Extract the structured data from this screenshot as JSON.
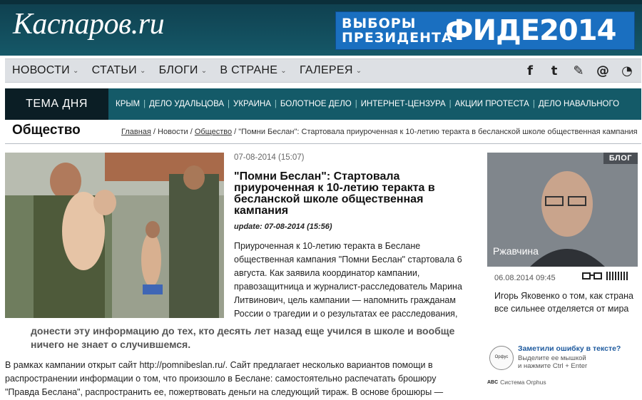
{
  "header": {
    "logo": "Каспаров.ru",
    "banner_left": "ВЫБОРЫ ПРЕЗИДЕНТА",
    "banner_right": "ФИДЕ2014"
  },
  "nav": {
    "items": [
      {
        "label": "НОВОСТИ"
      },
      {
        "label": "СТАТЬИ"
      },
      {
        "label": "БЛОГИ"
      },
      {
        "label": "В СТРАНЕ"
      },
      {
        "label": "ГАЛЕРЕЯ"
      }
    ],
    "social": [
      {
        "icon": "facebook-icon",
        "glyph": "f"
      },
      {
        "icon": "twitter-icon",
        "glyph": "t"
      },
      {
        "icon": "livejournal-icon",
        "glyph": "✎"
      },
      {
        "icon": "email-icon",
        "glyph": "@"
      },
      {
        "icon": "rss-icon",
        "glyph": "◔"
      }
    ]
  },
  "topic": {
    "label": "ТЕМА ДНЯ",
    "links": [
      "КРЫМ",
      "ДЕЛО УДАЛЬЦОВА",
      "УКРАИНА",
      "БОЛОТНОЕ ДЕЛО",
      "ИНТЕРНЕТ-ЦЕНЗУРА",
      "АКЦИИ ПРОТЕСТА",
      "ДЕЛО НАВАЛЬНОГО"
    ],
    "separator": "|"
  },
  "section": {
    "title": "Общество",
    "crumb_home": "Главная",
    "crumb_news": "Новости",
    "crumb_society": "Общество",
    "crumb_sep": " / ",
    "crumb_current": "\"Помни Беслан\": Стартовала приуроченная к 10-летию теракта в бесланской школе общественная кампания"
  },
  "article": {
    "date": "07-08-2014 (15:07)",
    "title": "\"Помни Беслан\": Стартовала приуроченная к 10-летию теракта в бесланской школе общественная кампания",
    "update": "update: 07-08-2014 (15:56)",
    "paragraph1": "Приуроченная к 10-летию теракта в Беслане общественная кампания \"Помни Беслан\" стартовала 6 августа. Как заявила координатор кампании, правозащитница и журналист-расследователь Марина Литвинович, цель кампании — напомнить гражданам России о трагедии и о результатах ее расследования,",
    "quote": "донести эту информацию до тех, кто десять лет назад еще учился в школе и вообще ничего не знает о случившемся.",
    "paragraph2": "В рамках кампании открыт сайт http://pomnibeslan.ru/. Сайт предлагает несколько вариантов помощи в распространении информации о том, что произошло в Беслане: самостоятельно распечатать брошюру \"Правда Беслана\", распространить ее, пожертвовать деньги на следующий тираж. В основе брошюры —"
  },
  "blog": {
    "badge": "БЛОГ",
    "name": "Ржавчина",
    "date": "06.08.2014 09:45",
    "text": "Игорь Яковенко о том, как страна все сильнее отделяется от мира"
  },
  "orphus": {
    "logo": "Орфус",
    "title": "Заметили ошибку в тексте?",
    "line1": "Выделите ее мышкой",
    "line2": "и нажмите Ctrl + Enter",
    "system": "Система Orphus",
    "mini": "ABC"
  }
}
